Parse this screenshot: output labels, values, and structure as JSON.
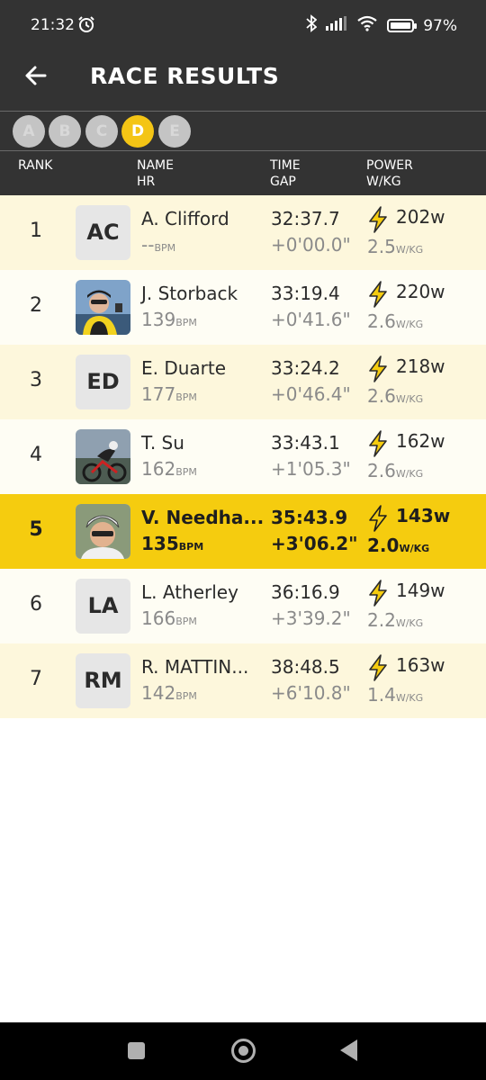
{
  "status": {
    "time": "21:32",
    "battery": "97%"
  },
  "header": {
    "title": "RACE RESULTS"
  },
  "categories": [
    "A",
    "B",
    "C",
    "D",
    "E"
  ],
  "active_category": "D",
  "columns": {
    "rank": "RANK",
    "name": "NAME",
    "hr": "HR",
    "time": "TIME",
    "gap": "GAP",
    "power": "POWER",
    "wkg": "W/KG"
  },
  "units": {
    "bpm": "BPM",
    "wkg": "W/KG"
  },
  "results": [
    {
      "rank": "1",
      "initials": "AC",
      "name": "A. Clifford",
      "hr": "--",
      "time": "32:37.7",
      "gap": "+0'00.0\"",
      "power": "202w",
      "wkg": "2.5"
    },
    {
      "rank": "2",
      "initials": "",
      "name": "J. Storback",
      "hr": "139",
      "time": "33:19.4",
      "gap": "+0'41.6\"",
      "power": "220w",
      "wkg": "2.6"
    },
    {
      "rank": "3",
      "initials": "ED",
      "name": "E. Duarte",
      "hr": "177",
      "time": "33:24.2",
      "gap": "+0'46.4\"",
      "power": "218w",
      "wkg": "2.6"
    },
    {
      "rank": "4",
      "initials": "",
      "name": "T. Su",
      "hr": "162",
      "time": "33:43.1",
      "gap": "+1'05.3\"",
      "power": "162w",
      "wkg": "2.6"
    },
    {
      "rank": "5",
      "initials": "",
      "name": "V. Needha...",
      "hr": "135",
      "time": "35:43.9",
      "gap": "+3'06.2\"",
      "power": "143w",
      "wkg": "2.0"
    },
    {
      "rank": "6",
      "initials": "LA",
      "name": "L. Atherley",
      "hr": "166",
      "time": "36:16.9",
      "gap": "+3'39.2\"",
      "power": "149w",
      "wkg": "2.2"
    },
    {
      "rank": "7",
      "initials": "RM",
      "name": "R. MATTIN...",
      "hr": "142",
      "time": "38:48.5",
      "gap": "+6'10.8\"",
      "power": "163w",
      "wkg": "1.4"
    }
  ],
  "colors": {
    "accent": "#f5cc0f",
    "dark": "#333333",
    "row_odd": "#fdf7dc",
    "row_even": "#fefdf4"
  }
}
